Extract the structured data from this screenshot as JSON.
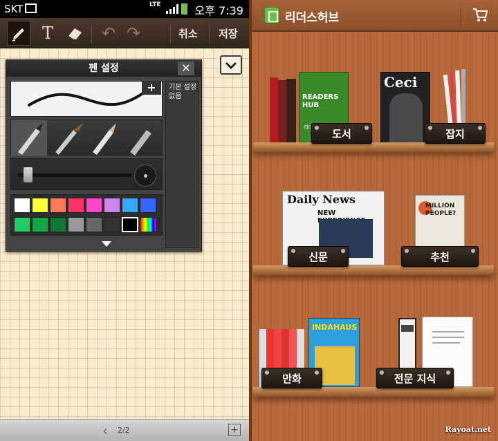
{
  "status_bar": {
    "carrier": "SKT",
    "network": "LTE",
    "time": "오후 7:39"
  },
  "note_toolbar": {
    "cancel_label": "취소",
    "save_label": "저장"
  },
  "pen_settings": {
    "title": "펜 설정",
    "side_note": "기본 설정 없음",
    "plus_label": "+",
    "close_label": "✕",
    "swatches": [
      "#ffffff",
      "#ffff33",
      "#ff7a55",
      "#ff3366",
      "#ff44cc",
      "#cc88ee",
      "#33aaff",
      "#3366ff",
      "#22cc66",
      "#11aa44",
      "#117733",
      "#999999",
      "#666666",
      "#333333",
      "#000000",
      "rainbow"
    ],
    "selected_swatch_index": 14
  },
  "note_footer": {
    "page_indicator": "2/2"
  },
  "reader_hub": {
    "app_title": "리더스허브",
    "shelves": [
      {
        "label": "도서",
        "book_text": "READERS HUB",
        "book_subtext": "리더스허브 소개"
      },
      {
        "label": "잡지",
        "book_text": "Ceci"
      },
      {
        "label": "신문",
        "book_text": "Daily News",
        "book_subtext": "NEW EXPERIENCE"
      },
      {
        "label": "추천",
        "book_text": "MILLION PEOPLE?"
      },
      {
        "label": "만화",
        "book_text": "INDAHAUS"
      },
      {
        "label": "전문 지식"
      }
    ],
    "watermark": "Rayoat.net"
  },
  "colors": {
    "toolbar_brown": "#3b2d20",
    "paper": "#f6ebcf",
    "wood": "#b8693a",
    "logo_green": "#6cc04a"
  }
}
